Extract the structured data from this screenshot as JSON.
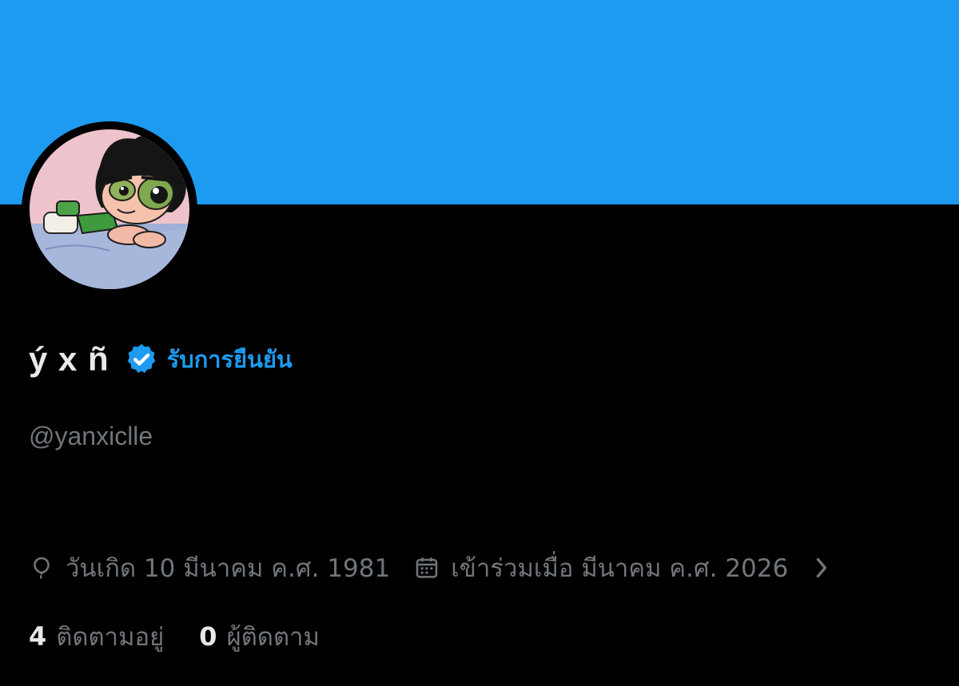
{
  "theme": {
    "banner_color": "#1d9bf0",
    "background": "#000000",
    "accent": "#1d9bf0",
    "primary_text": "#e7e9ea",
    "secondary_text": "#71767b"
  },
  "profile": {
    "display_name": "ý x ñ",
    "verify_label": "รับการยืนยัน",
    "handle": "@yanxiclle",
    "avatar_icon": "buttercup-avatar"
  },
  "meta": {
    "birthday_icon": "balloon-icon",
    "birthday": "วันเกิด 10 มีนาคม ค.ศ. 1981",
    "joined_icon": "calendar-icon",
    "joined": "เข้าร่วมเมื่อ มีนาคม ค.ศ. 2026",
    "more_icon": "chevron-right-icon"
  },
  "stats": {
    "following_count": "4",
    "following_label": "ติดตามอยู่",
    "followers_count": "0",
    "followers_label": "ผู้ติดตาม"
  }
}
